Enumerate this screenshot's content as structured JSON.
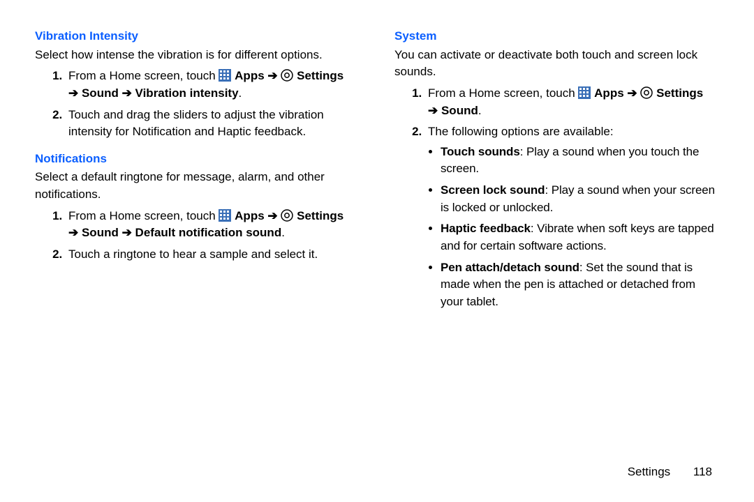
{
  "arrow": "➔",
  "left": {
    "vib": {
      "heading": "Vibration Intensity",
      "intro": "Select how intense the vibration is for different options.",
      "step1_a": "From a Home screen, touch ",
      "step1_apps": " Apps ",
      "step1_settings": " Settings",
      "step1_b": " Sound ",
      "step1_c": " Vibration intensity",
      "step1_end": ".",
      "step2": "Touch and drag the sliders to adjust the vibration intensity for Notification and Haptic feedback."
    },
    "notif": {
      "heading": "Notifications",
      "intro": "Select a default ringtone for message, alarm, and other notifications.",
      "step1_a": "From a Home screen, touch ",
      "step1_apps": " Apps ",
      "step1_settings": " Settings",
      "step1_b": " Sound ",
      "step1_c": " Default notification sound",
      "step1_end": ".",
      "step2": "Touch a ringtone to hear a sample and select it."
    }
  },
  "right": {
    "sys": {
      "heading": "System",
      "intro": "You can activate or deactivate both touch and screen lock sounds.",
      "step1_a": "From a Home screen, touch ",
      "step1_apps": " Apps ",
      "step1_settings": " Settings",
      "step1_b": " Sound",
      "step1_end": ".",
      "step2": "The following options are available:",
      "bullets": {
        "b0_t": "Touch sounds",
        "b0_d": ": Play a sound when you touch the screen.",
        "b1_t": "Screen lock sound",
        "b1_d": ": Play a sound when your screen is locked or unlocked.",
        "b2_t": "Haptic feedback",
        "b2_d": ": Vibrate when soft keys are tapped and for certain software actions.",
        "b3_t": "Pen attach/detach sound",
        "b3_d": ": Set the sound that is made when the pen is attached or detached from your tablet."
      }
    }
  },
  "footer": {
    "section": "Settings",
    "page": "118"
  }
}
